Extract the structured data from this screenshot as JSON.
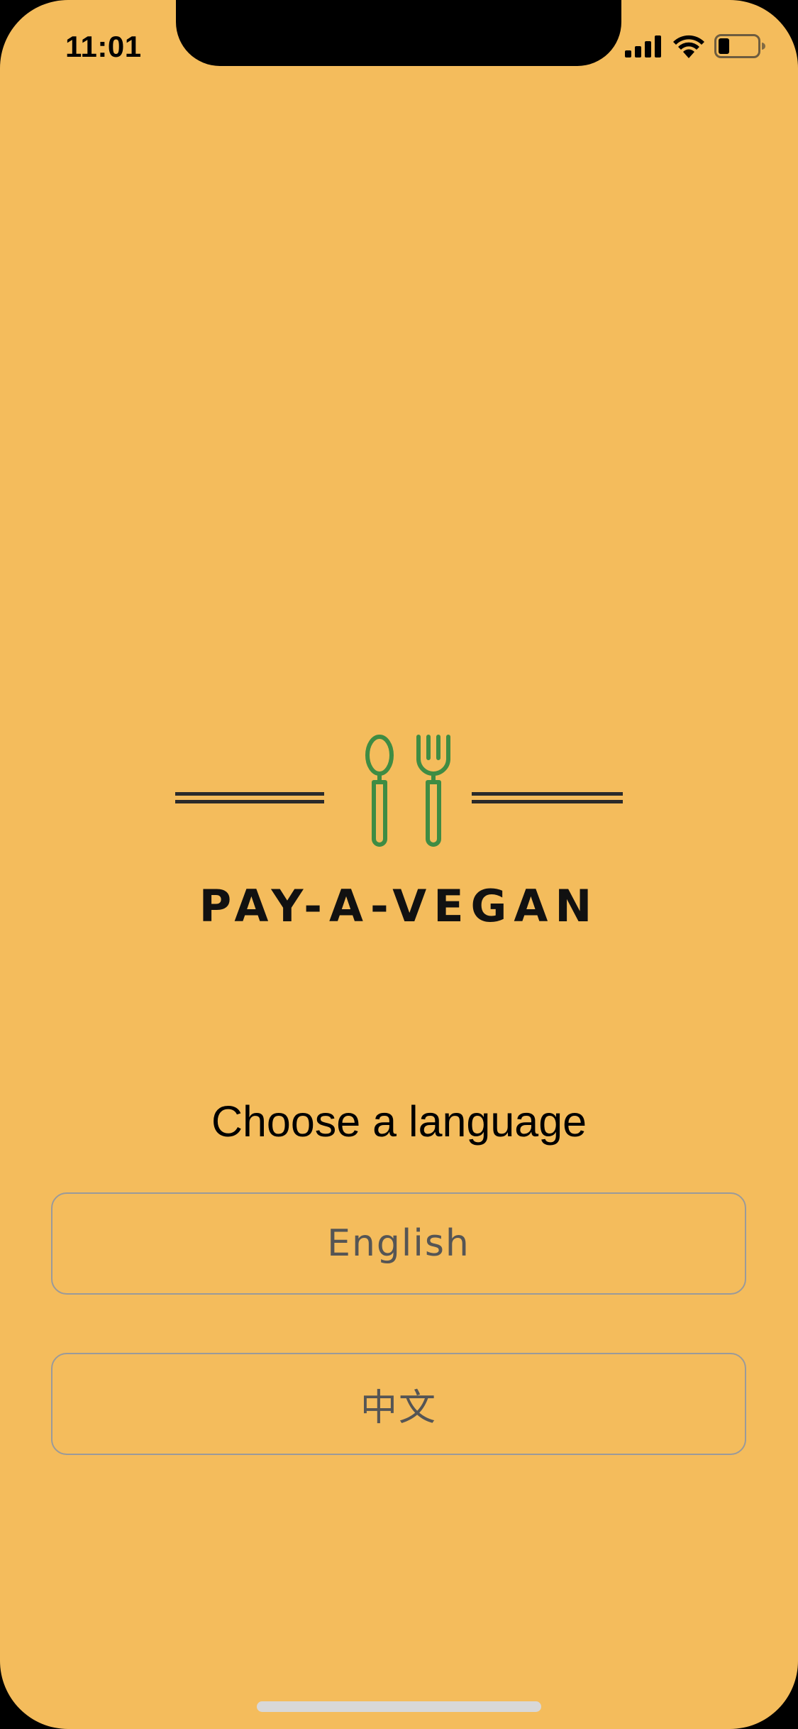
{
  "status_bar": {
    "time": "11:01",
    "icons": [
      "cellular-signal-icon",
      "wifi-icon",
      "battery-icon"
    ]
  },
  "logo": {
    "icon_names": [
      "spoon-icon",
      "fork-icon"
    ],
    "brand_name": "PAY-A-VEGAN",
    "icon_color": "#3F8C43"
  },
  "language_screen": {
    "prompt": "Choose a language",
    "options": [
      {
        "label": "English"
      },
      {
        "label": "中文"
      }
    ]
  },
  "colors": {
    "background": "#F4BC5C",
    "button_border": "#9A9A9A",
    "button_text": "#555555"
  }
}
